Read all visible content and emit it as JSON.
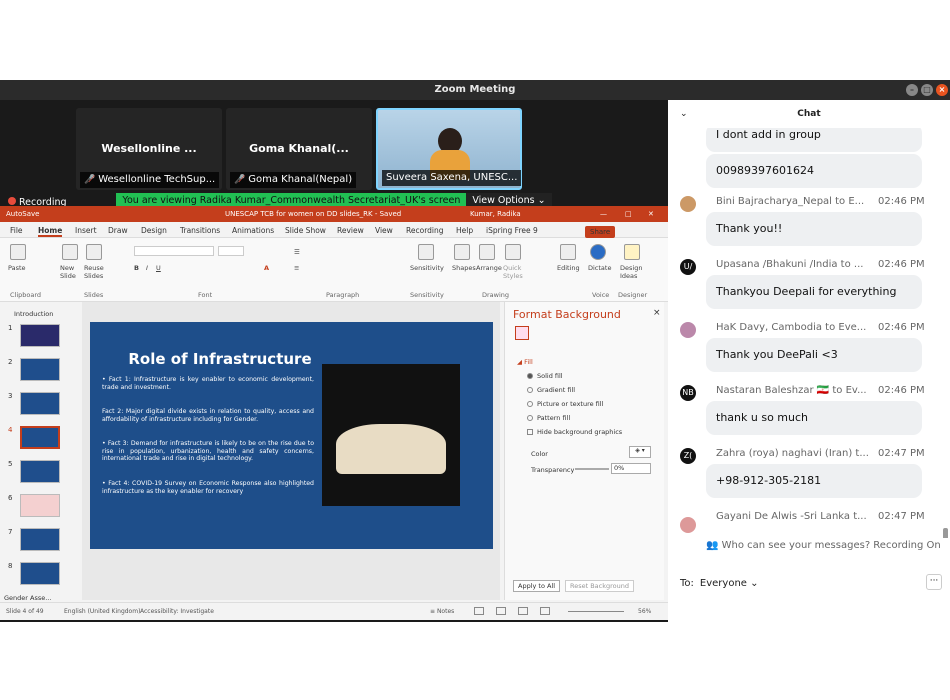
{
  "window": {
    "title": "Zoom Meeting"
  },
  "tiles": [
    {
      "name": "Wesellonline ...",
      "label": "Wesellonline TechSup..."
    },
    {
      "name": "Goma Khanal(...",
      "label": "Goma Khanal(Nepal)"
    },
    {
      "label": "Suveera Saxena, UNESC..."
    }
  ],
  "share": {
    "message": "You are viewing Radika Kumar_Commonwealth Secretariat_UK's screen",
    "view_options": "View Options",
    "recording": "Recording"
  },
  "ppt": {
    "autosave": "AutoSave",
    "file_title": "UNESCAP TCB for women on DD slides_RK - Saved",
    "user": "Kumar, Radika",
    "menu": [
      "File",
      "Home",
      "Insert",
      "Draw",
      "Design",
      "Transitions",
      "Animations",
      "Slide Show",
      "Review",
      "View",
      "Recording",
      "Help",
      "iSpring Free 9"
    ],
    "share": "Share",
    "ribbon": {
      "paste": "Paste",
      "new_slide": "New Slide",
      "reuse": "Reuse Slides",
      "sensitivity": "Sensitivity",
      "shapes": "Shapes",
      "arrange": "Arrange",
      "quick_styles": "Quick Styles",
      "editing": "Editing",
      "dictate": "Dictate",
      "design_ideas": "Design Ideas",
      "groups": [
        "Clipboard",
        "Slides",
        "Font",
        "Paragraph",
        "Sensitivity",
        "Drawing",
        "Voice",
        "Designer"
      ]
    },
    "section1": "Introduction",
    "section2": "Gender Asse...",
    "slide_numbers": [
      "1",
      "2",
      "3",
      "4",
      "5",
      "6",
      "7",
      "8"
    ],
    "slide": {
      "title": "Role of Infrastructure",
      "facts": [
        "• Fact 1: Infrastructure is key enabler to economic development, trade and investment.",
        "Fact 2: Major digital divide exists in relation to quality, access and affordability of infrastructure including for Gender.",
        "• Fact 3: Demand for infrastructure is likely to be on the rise due to rise in population, urbanization, health and safety concerns, international trade and rise in digital technology.",
        "• Fact 4: COVID-19 Survey on Economic Response also highlighted infrastructure as the key enabler for recovery"
      ]
    },
    "format_bg": {
      "title": "Format Background",
      "fill": "Fill",
      "options": [
        "Solid fill",
        "Gradient fill",
        "Picture or texture fill",
        "Pattern fill"
      ],
      "hide": "Hide background graphics",
      "color": "Color",
      "transparency": "Transparency",
      "transparency_val": "0%",
      "apply_all": "Apply to All",
      "reset": "Reset Background"
    },
    "status": {
      "slide": "Slide 4 of 49",
      "lang": "English (United Kingdom)",
      "access": "Accessibility: Investigate",
      "notes": "Notes",
      "zoom": "56%"
    }
  },
  "chat": {
    "header": "Chat",
    "messages": [
      {
        "text": "I dont add in group"
      },
      {
        "text": "00989397601624"
      },
      {
        "sender": "Bini Bajracharya_Nepal to E...",
        "time": "02:46 PM",
        "text": "Thank you!!"
      },
      {
        "avatar": "U/",
        "sender": "Upasana /Bhakuni /India to ...",
        "time": "02:46 PM",
        "text": "Thankyou Deepali for everything"
      },
      {
        "sender": "HaK Davy, Cambodia to Eve...",
        "time": "02:46 PM",
        "text": "Thank you DeePali <3"
      },
      {
        "avatar": "NB",
        "sender": "Nastaran Baleshzar 🇮🇷 to Ev...",
        "time": "02:46 PM",
        "text": "thank u so much"
      },
      {
        "avatar": "Z(",
        "sender": "Zahra (roya) naghavi (Iran) t...",
        "time": "02:47 PM",
        "text": "+98-912-305-2181"
      },
      {
        "sender": "Gayani De Alwis -Sri Lanka t...",
        "time": "02:47 PM"
      }
    ],
    "notice": "Who can see your messages? Recording On",
    "to_label": "To:",
    "to_value": "Everyone"
  }
}
